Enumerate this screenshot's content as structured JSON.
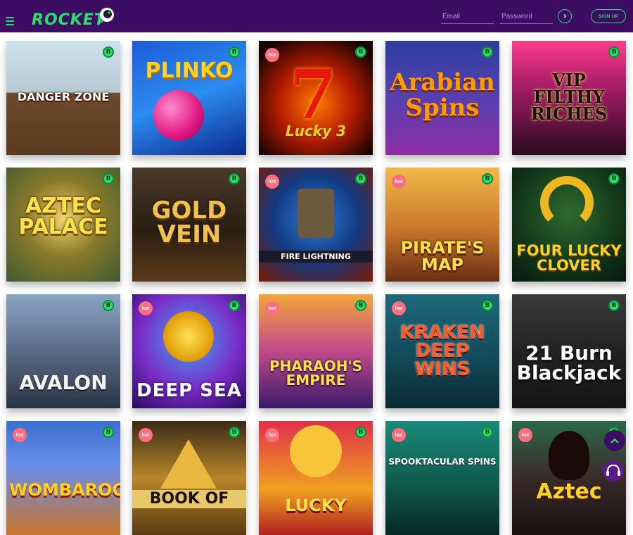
{
  "header": {
    "brand": "ROCKET",
    "email_placeholder": "Email",
    "password_placeholder": "Password",
    "signup_label": "SIGN UP"
  },
  "badges": {
    "hot": "hot",
    "btc": "B"
  },
  "colors": {
    "header_bg": "#3d0d63",
    "accent": "#27e36a",
    "hot": "#ff6d7e"
  },
  "games": [
    {
      "title": "DANGER ZONE",
      "hot": false
    },
    {
      "title": "PLINKO",
      "hot": false
    },
    {
      "title": "Lucky 3",
      "hot": true
    },
    {
      "title": "Arabian Spins",
      "hot": false
    },
    {
      "title": "VIP FILTHY RICHES",
      "hot": false
    },
    {
      "title": "AZTEC PALACE",
      "hot": false
    },
    {
      "title": "GOLD VEIN",
      "hot": false
    },
    {
      "title": "FIRE LIGHTNING",
      "hot": true
    },
    {
      "title": "PIRATE'S MAP",
      "hot": true
    },
    {
      "title": "FOUR LUCKY CLOVER",
      "hot": false
    },
    {
      "title": "AVALON",
      "hot": false
    },
    {
      "title": "DEEP SEA",
      "hot": true
    },
    {
      "title": "PHARAOH'S EMPIRE",
      "hot": true
    },
    {
      "title": "KRAKEN DEEP WINS",
      "hot": true
    },
    {
      "title": "21 Burn Blackjack",
      "hot": false
    },
    {
      "title": "WOMBAROO",
      "hot": true
    },
    {
      "title": "BOOK OF",
      "hot": true
    },
    {
      "title": "LUCKY",
      "hot": true
    },
    {
      "title": "SPOOKTACULAR SPINS",
      "hot": true
    },
    {
      "title": "Aztec",
      "hot": true
    }
  ]
}
